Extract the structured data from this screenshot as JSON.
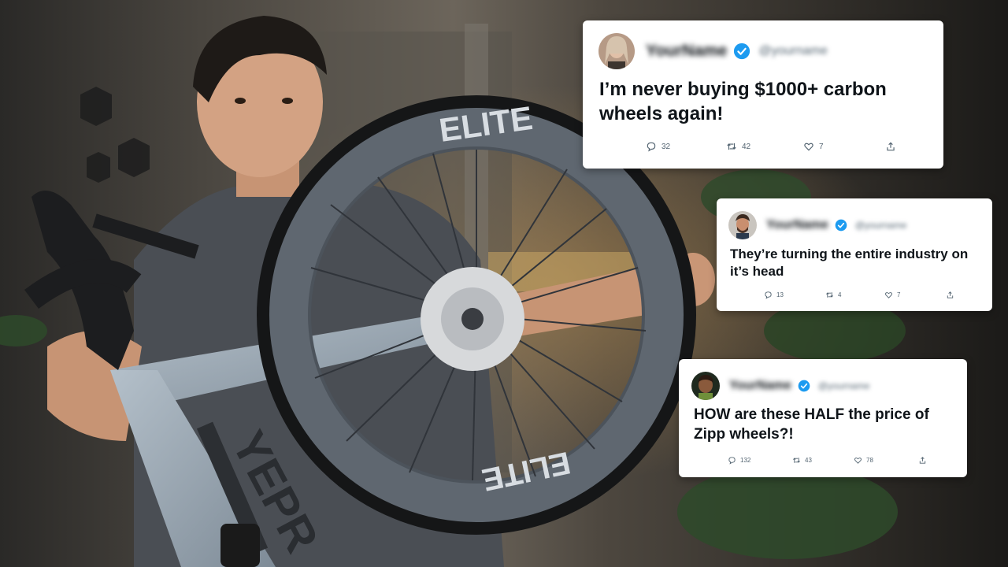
{
  "colors": {
    "verified_blue": "#1d9bf0",
    "card_bg": "#ffffff",
    "text": "#0f1419",
    "muted": "#536471",
    "bike_frame": "#9aa7b3",
    "wheel_rim": "#5f6770"
  },
  "photo": {
    "subject": "man holding road bike and carbon wheel",
    "rim_brand_text": "ELITE",
    "frame_brand_text": "YEPR"
  },
  "tweets": [
    {
      "display_name": "YourName",
      "handle": "@yourname",
      "verified": true,
      "text": "I’m never buying $1000+ carbon wheels again!",
      "replies": "32",
      "retweets": "42",
      "likes": "7",
      "icons": [
        "reply-icon",
        "retweet-icon",
        "like-icon",
        "share-icon"
      ]
    },
    {
      "display_name": "YourName",
      "handle": "@yourname",
      "verified": true,
      "text": "They’re turning the entire industry on it’s head",
      "replies": "13",
      "retweets": "4",
      "likes": "7",
      "icons": [
        "reply-icon",
        "retweet-icon",
        "like-icon",
        "share-icon"
      ]
    },
    {
      "display_name": "YourName",
      "handle": "@yourname",
      "verified": true,
      "text": "HOW are these HALF the price of Zipp wheels?!",
      "replies": "132",
      "retweets": "43",
      "likes": "78",
      "icons": [
        "reply-icon",
        "retweet-icon",
        "like-icon",
        "share-icon"
      ]
    }
  ]
}
